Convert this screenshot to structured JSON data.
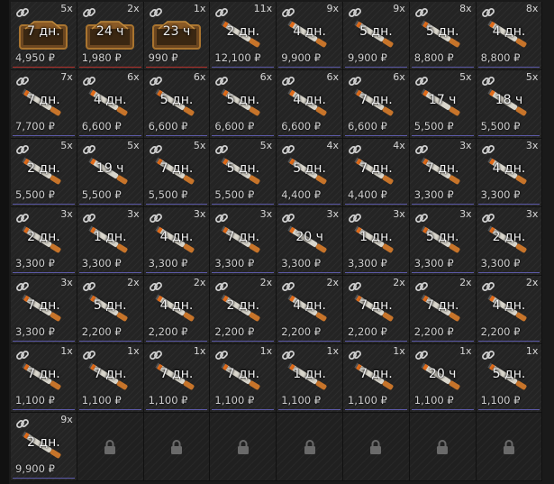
{
  "colors": {
    "bar_normal": "#5c5aa8",
    "bar_highlight": "#b3322d"
  },
  "icons": {
    "link": "link-icon",
    "lock": "lock-icon",
    "item": "cigarette-item-icon",
    "box": "wooden-box-item-icon"
  },
  "slots": [
    {
      "qty": "5x",
      "duration": "7 дн.",
      "price": "4,950 ₽",
      "item": "box",
      "highlight": true
    },
    {
      "qty": "2x",
      "duration": "24 ч",
      "price": "1,980 ₽",
      "item": "box",
      "highlight": true
    },
    {
      "qty": "1x",
      "duration": "23 ч",
      "price": "990 ₽",
      "item": "box",
      "highlight": true
    },
    {
      "qty": "11x",
      "duration": "2 дн.",
      "price": "12,100 ₽",
      "item": "cigarette"
    },
    {
      "qty": "9x",
      "duration": "4 дн.",
      "price": "9,900 ₽",
      "item": "cigarette"
    },
    {
      "qty": "9x",
      "duration": "5 дн.",
      "price": "9,900 ₽",
      "item": "cigarette"
    },
    {
      "qty": "8x",
      "duration": "5 дн.",
      "price": "8,800 ₽",
      "item": "cigarette"
    },
    {
      "qty": "8x",
      "duration": "4 дн.",
      "price": "8,800 ₽",
      "item": "cigarette"
    },
    {
      "qty": "7x",
      "duration": "7 дн.",
      "price": "7,700 ₽",
      "item": "cigarette"
    },
    {
      "qty": "6x",
      "duration": "4 дн.",
      "price": "6,600 ₽",
      "item": "cigarette"
    },
    {
      "qty": "6x",
      "duration": "5 дн.",
      "price": "6,600 ₽",
      "item": "cigarette"
    },
    {
      "qty": "6x",
      "duration": "5 дн.",
      "price": "6,600 ₽",
      "item": "cigarette"
    },
    {
      "qty": "6x",
      "duration": "4 дн.",
      "price": "6,600 ₽",
      "item": "cigarette"
    },
    {
      "qty": "6x",
      "duration": "7 дн.",
      "price": "6,600 ₽",
      "item": "cigarette"
    },
    {
      "qty": "5x",
      "duration": "17 ч",
      "price": "5,500 ₽",
      "item": "cigarette"
    },
    {
      "qty": "5x",
      "duration": "18 ч",
      "price": "5,500 ₽",
      "item": "cigarette"
    },
    {
      "qty": "5x",
      "duration": "2 дн.",
      "price": "5,500 ₽",
      "item": "cigarette"
    },
    {
      "qty": "5x",
      "duration": "19 ч",
      "price": "5,500 ₽",
      "item": "cigarette"
    },
    {
      "qty": "5x",
      "duration": "7 дн.",
      "price": "5,500 ₽",
      "item": "cigarette"
    },
    {
      "qty": "5x",
      "duration": "5 дн.",
      "price": "5,500 ₽",
      "item": "cigarette"
    },
    {
      "qty": "4x",
      "duration": "5 дн.",
      "price": "4,400 ₽",
      "item": "cigarette"
    },
    {
      "qty": "4x",
      "duration": "7 дн.",
      "price": "4,400 ₽",
      "item": "cigarette"
    },
    {
      "qty": "3x",
      "duration": "7 дн.",
      "price": "3,300 ₽",
      "item": "cigarette"
    },
    {
      "qty": "3x",
      "duration": "4 дн.",
      "price": "3,300 ₽",
      "item": "cigarette"
    },
    {
      "qty": "3x",
      "duration": "2 дн.",
      "price": "3,300 ₽",
      "item": "cigarette"
    },
    {
      "qty": "3x",
      "duration": "1 дн.",
      "price": "3,300 ₽",
      "item": "cigarette"
    },
    {
      "qty": "3x",
      "duration": "4 дн.",
      "price": "3,300 ₽",
      "item": "cigarette"
    },
    {
      "qty": "3x",
      "duration": "7 дн.",
      "price": "3,300 ₽",
      "item": "cigarette"
    },
    {
      "qty": "3x",
      "duration": "20 ч",
      "price": "3,300 ₽",
      "item": "cigarette"
    },
    {
      "qty": "3x",
      "duration": "1 дн.",
      "price": "3,300 ₽",
      "item": "cigarette"
    },
    {
      "qty": "3x",
      "duration": "5 дн.",
      "price": "3,300 ₽",
      "item": "cigarette"
    },
    {
      "qty": "3x",
      "duration": "2 дн.",
      "price": "3,300 ₽",
      "item": "cigarette"
    },
    {
      "qty": "3x",
      "duration": "7 дн.",
      "price": "3,300 ₽",
      "item": "cigarette"
    },
    {
      "qty": "2x",
      "duration": "5 дн.",
      "price": "2,200 ₽",
      "item": "cigarette"
    },
    {
      "qty": "2x",
      "duration": "4 дн.",
      "price": "2,200 ₽",
      "item": "cigarette"
    },
    {
      "qty": "2x",
      "duration": "2 дн.",
      "price": "2,200 ₽",
      "item": "cigarette"
    },
    {
      "qty": "2x",
      "duration": "4 дн.",
      "price": "2,200 ₽",
      "item": "cigarette"
    },
    {
      "qty": "2x",
      "duration": "7 дн.",
      "price": "2,200 ₽",
      "item": "cigarette"
    },
    {
      "qty": "2x",
      "duration": "7 дн.",
      "price": "2,200 ₽",
      "item": "cigarette"
    },
    {
      "qty": "2x",
      "duration": "4 дн.",
      "price": "2,200 ₽",
      "item": "cigarette"
    },
    {
      "qty": "1x",
      "duration": "7 дн.",
      "price": "1,100 ₽",
      "item": "cigarette"
    },
    {
      "qty": "1x",
      "duration": "7 дн.",
      "price": "1,100 ₽",
      "item": "cigarette"
    },
    {
      "qty": "1x",
      "duration": "7 дн.",
      "price": "1,100 ₽",
      "item": "cigarette"
    },
    {
      "qty": "1x",
      "duration": "7 дн.",
      "price": "1,100 ₽",
      "item": "cigarette"
    },
    {
      "qty": "1x",
      "duration": "1 дн.",
      "price": "1,100 ₽",
      "item": "cigarette"
    },
    {
      "qty": "1x",
      "duration": "7 дн.",
      "price": "1,100 ₽",
      "item": "cigarette"
    },
    {
      "qty": "1x",
      "duration": "20 ч",
      "price": "1,100 ₽",
      "item": "cigarette"
    },
    {
      "qty": "1x",
      "duration": "5 дн.",
      "price": "1,100 ₽",
      "item": "cigarette"
    },
    {
      "qty": "9x",
      "duration": "2 дн.",
      "price": "9,900 ₽",
      "item": "cigarette"
    },
    {
      "locked": true
    },
    {
      "locked": true
    },
    {
      "locked": true
    },
    {
      "locked": true
    },
    {
      "locked": true
    },
    {
      "locked": true
    },
    {
      "locked": true
    }
  ]
}
